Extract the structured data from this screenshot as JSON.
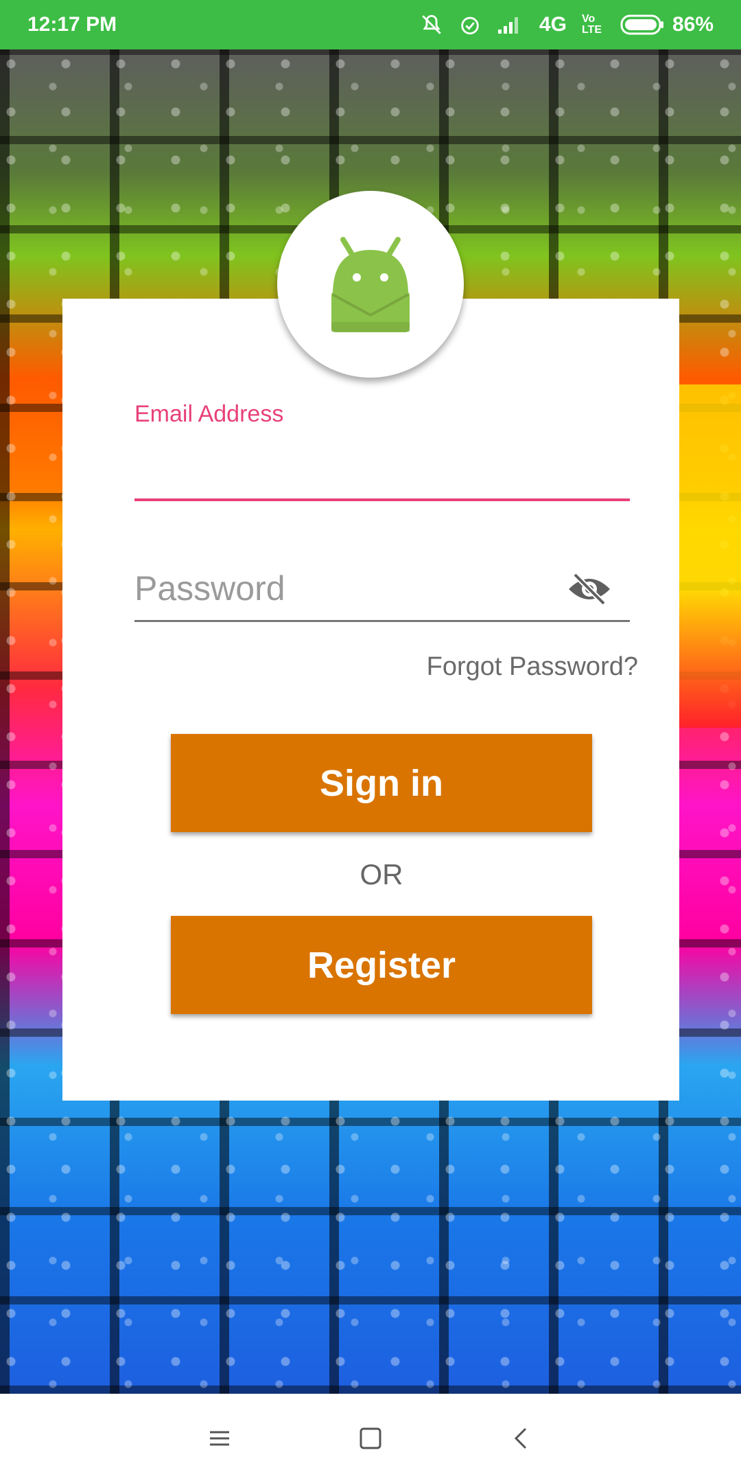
{
  "status_bar": {
    "time": "12:17 PM",
    "network": "4G",
    "volte": "Vo LTE",
    "battery_percent": "86%",
    "icons": [
      "bell-off-icon",
      "alarm-icon",
      "signal-icon",
      "4g-icon",
      "volte-icon",
      "battery-icon"
    ]
  },
  "form": {
    "email_label": "Email Address",
    "email_value": "",
    "password_placeholder": "Password",
    "password_value": "",
    "forgot_password": "Forgot Password?",
    "sign_in": "Sign in",
    "or_text": "OR",
    "register": "Register"
  },
  "colors": {
    "status_bar": "#3dbd45",
    "accent_pink": "#e8407a",
    "button_orange": "#d97401",
    "android_green": "#8bc34a"
  },
  "nav_bar": {
    "icons": [
      "menu-icon",
      "home-icon",
      "back-icon"
    ]
  }
}
